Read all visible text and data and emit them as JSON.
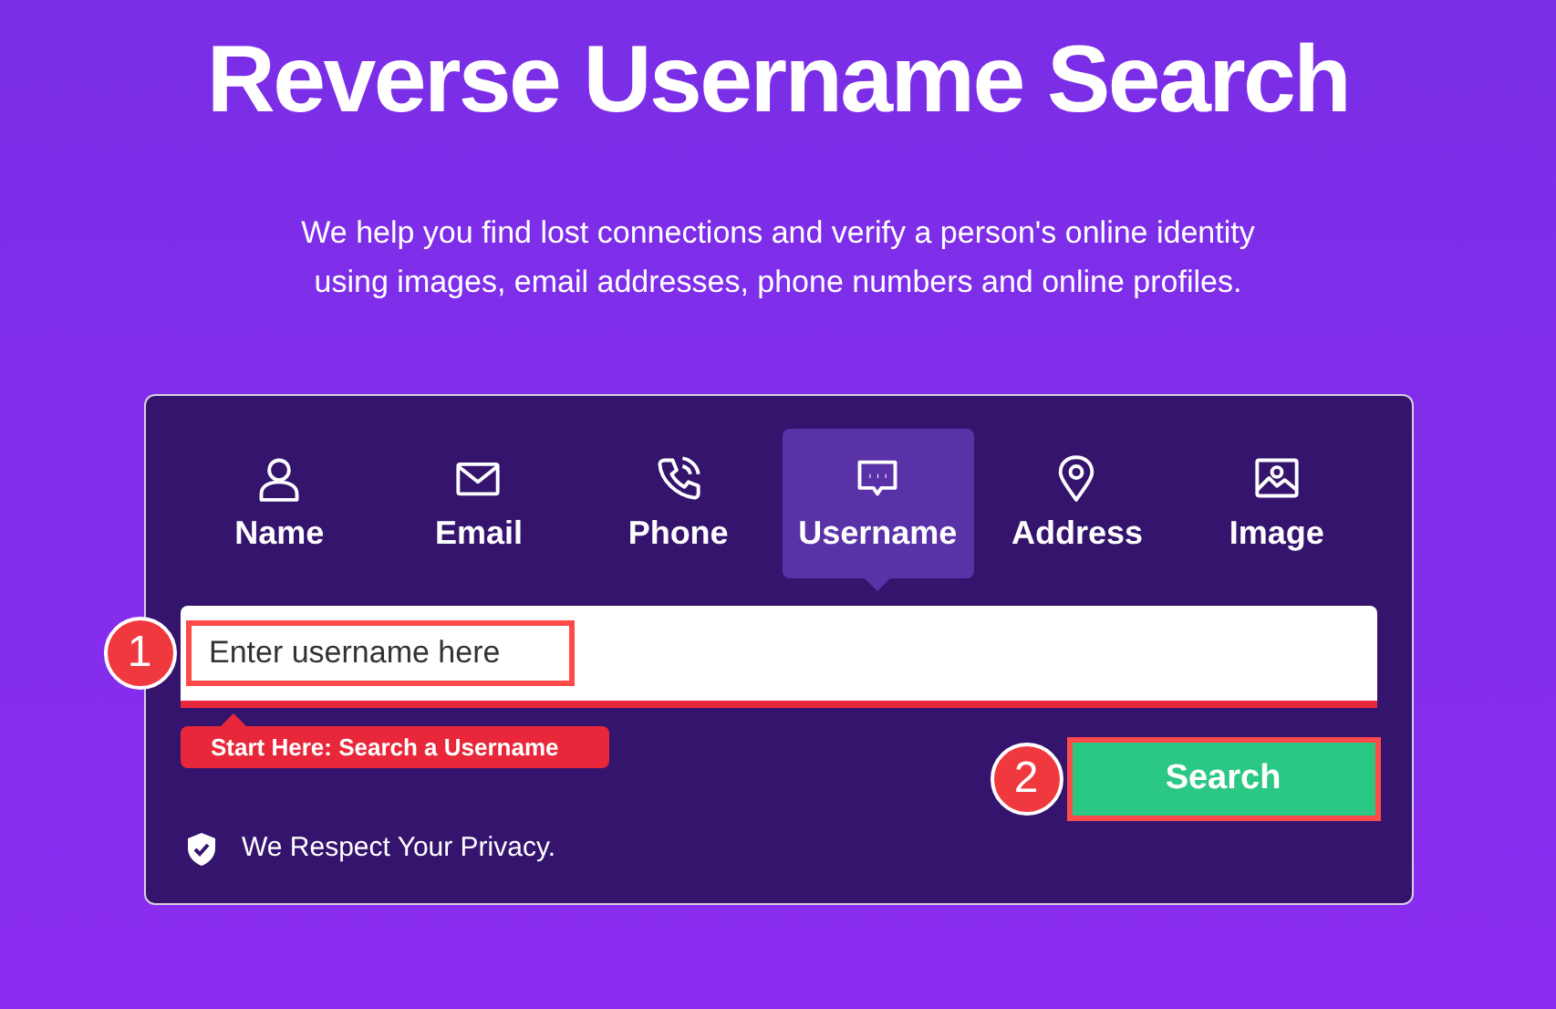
{
  "title": "Reverse Username Search",
  "description": "We help you find lost connections and verify a person's online identity using images, email addresses, phone numbers and online profiles.",
  "tabs": [
    {
      "label": "Name",
      "kind": "person",
      "selected": false
    },
    {
      "label": "Email",
      "kind": "mail",
      "selected": false
    },
    {
      "label": "Phone",
      "kind": "phone",
      "selected": false
    },
    {
      "label": "Username",
      "kind": "chat",
      "selected": true
    },
    {
      "label": "Address",
      "kind": "pin",
      "selected": false
    },
    {
      "label": "Image",
      "kind": "image",
      "selected": false
    }
  ],
  "search_field": {
    "placeholder": "Enter username here",
    "step": "1"
  },
  "hint": "Start Here: Search a Username",
  "search_button": {
    "label": "Search",
    "step": "2"
  },
  "privacy_note": "We Respect Your Privacy."
}
